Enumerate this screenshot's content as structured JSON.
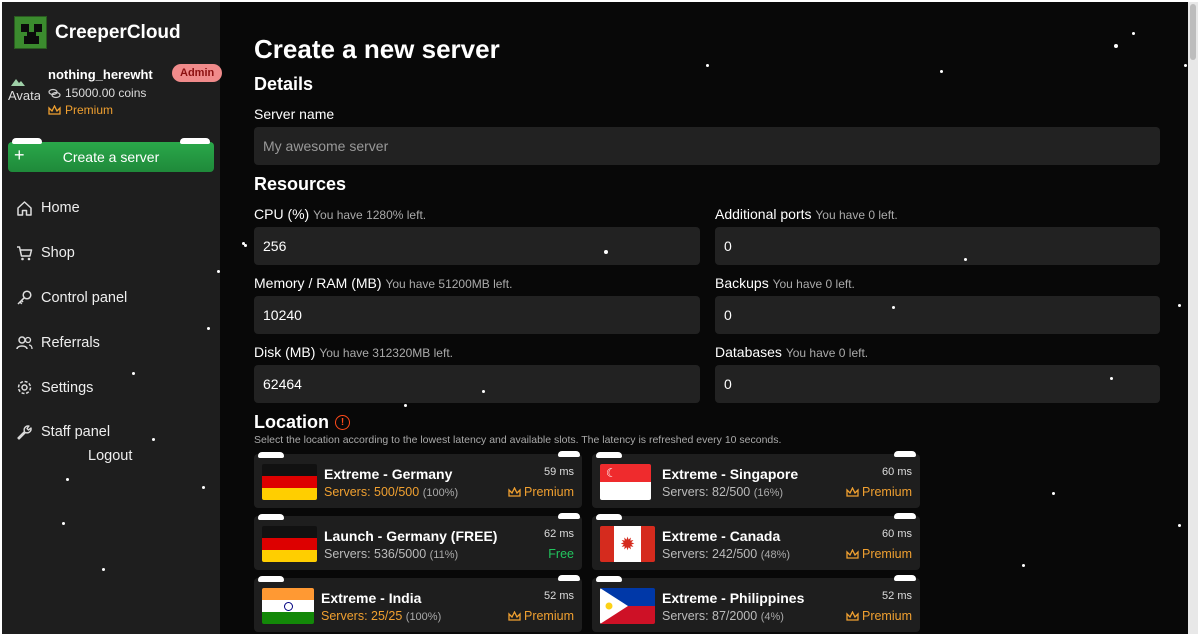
{
  "app": {
    "name": "CreeperCloud"
  },
  "user": {
    "avatar_alt": "Avatar",
    "name": "nothing_herewht",
    "role_badge": "Admin",
    "coins": "15000.00 coins",
    "tier": "Premium"
  },
  "sidebar": {
    "create_label": "Create a server",
    "items": [
      {
        "label": "Home",
        "icon": "home-icon"
      },
      {
        "label": "Shop",
        "icon": "cart-icon"
      },
      {
        "label": "Control panel",
        "icon": "key-icon"
      },
      {
        "label": "Referrals",
        "icon": "users-icon"
      },
      {
        "label": "Settings",
        "icon": "gear-icon"
      },
      {
        "label": "Staff panel",
        "icon": "wrench-icon"
      }
    ],
    "logout_label": "Logout"
  },
  "page": {
    "title": "Create a new server",
    "details_heading": "Details",
    "server_name_label": "Server name",
    "server_name_placeholder": "My awesome server",
    "resources_heading": "Resources",
    "resources": {
      "cpu": {
        "label": "CPU (%)",
        "hint": "You have 1280% left.",
        "value": "256"
      },
      "memory": {
        "label": "Memory / RAM (MB)",
        "hint": "You have 51200MB left.",
        "value": "10240"
      },
      "disk": {
        "label": "Disk (MB)",
        "hint": "You have 312320MB left.",
        "value": "62464"
      },
      "ports": {
        "label": "Additional ports",
        "hint": "You have 0 left.",
        "value": "0"
      },
      "backups": {
        "label": "Backups",
        "hint": "You have 0 left.",
        "value": "0"
      },
      "databases": {
        "label": "Databases",
        "hint": "You have 0 left.",
        "value": "0"
      }
    },
    "location_heading": "Location",
    "location_subtitle": "Select the location according to the lowest latency and available slots. The latency is refreshed every 10 seconds."
  },
  "locations": [
    {
      "name": "Extreme - Germany",
      "servers": "Servers: 500/500",
      "pct": "(100%)",
      "latency": "59 ms",
      "tier": "Premium",
      "flag": "de",
      "full": true
    },
    {
      "name": "Extreme - Singapore",
      "servers": "Servers: 82/500",
      "pct": "(16%)",
      "latency": "60 ms",
      "tier": "Premium",
      "flag": "sg",
      "full": false
    },
    {
      "name": "Launch - Germany (FREE)",
      "servers": "Servers: 536/5000",
      "pct": "(11%)",
      "latency": "62 ms",
      "tier": "Free",
      "flag": "de",
      "full": false
    },
    {
      "name": "Extreme - Canada",
      "servers": "Servers: 242/500",
      "pct": "(48%)",
      "latency": "60 ms",
      "tier": "Premium",
      "flag": "ca",
      "full": false
    },
    {
      "name": "Extreme - India",
      "servers": "Servers: 25/25",
      "pct": "(100%)",
      "latency": "52 ms",
      "tier": "Premium",
      "flag": "in",
      "full": true
    },
    {
      "name": "Extreme - Philippines",
      "servers": "Servers: 87/2000",
      "pct": "(4%)",
      "latency": "52 ms",
      "tier": "Premium",
      "flag": "ph",
      "full": false
    }
  ],
  "colors": {
    "accent_green": "#22c55e",
    "premium_gold": "#f0a030",
    "admin_badge": "#f08b8b",
    "warning": "#ff4a1a"
  }
}
